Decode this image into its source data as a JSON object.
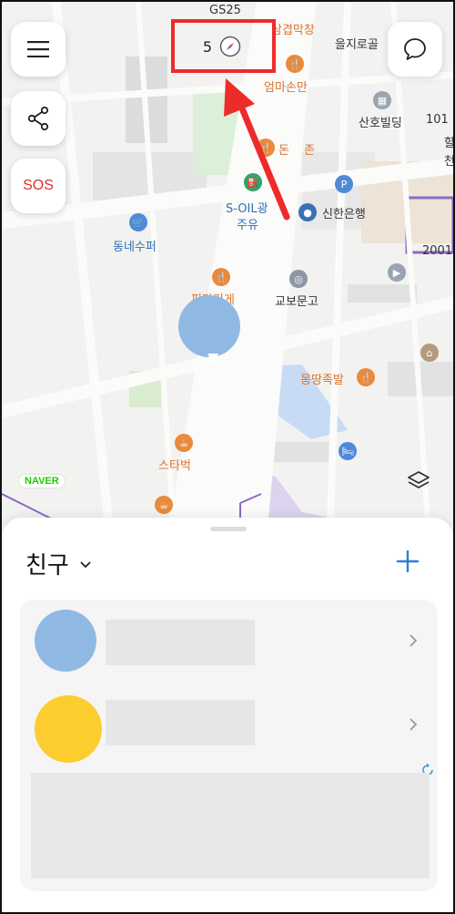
{
  "map": {
    "labels": {
      "gs25": "GS25",
      "samgyeopsal": "삼겹막창",
      "eulji_road": "을지로골",
      "emma_son": "엄마손만",
      "sanho": "산호빌딩",
      "num_101": "101",
      "don": "돈",
      "jon": "존",
      "s_oil": "S-OIL광",
      "juyu": "주유",
      "shinhan": "신한은행",
      "neighborhood_super": "동네수퍼",
      "kyobo": "교보문고",
      "pimari": "피마리게",
      "mongttang": "몽땅족발",
      "starbucks": "스타벅",
      "num_2001": "2001",
      "hal": "할",
      "cheon": "천"
    },
    "compass_level": "5",
    "naver_badge": "NAVER"
  },
  "buttons": {
    "sos": "SOS"
  },
  "sheet": {
    "title": "친구"
  },
  "colors": {
    "highlight": "#ee2b2b",
    "sos": "#d8302f",
    "add_button": "#2f7fd8",
    "friend1_avatar": "#8fb9e2",
    "friend2_avatar": "#fdcd2f"
  },
  "icons": {
    "menu": "menu-icon",
    "share": "share-icon",
    "chat": "chat-bubble-icon",
    "compass": "compass-icon",
    "layers": "layers-icon",
    "add": "plus-icon",
    "chevron_down": "chevron-down-icon",
    "chevron_right": "chevron-right-icon",
    "refresh": "refresh-icon"
  }
}
